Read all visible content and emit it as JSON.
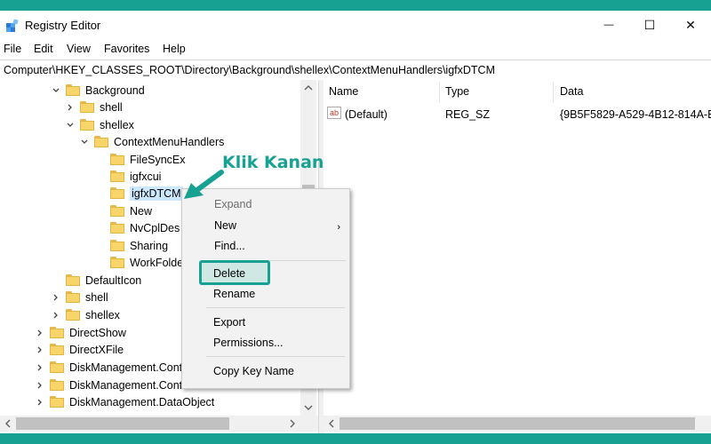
{
  "window": {
    "title": "Registry Editor",
    "minimize_glyph": "—",
    "maximize_glyph": "☐",
    "close_glyph": "✕"
  },
  "menubar": [
    "File",
    "Edit",
    "View",
    "Favorites",
    "Help"
  ],
  "address": "Computer\\HKEY_CLASSES_ROOT\\Directory\\Background\\shellex\\ContextMenuHandlers\\igfxDTCM",
  "tree": [
    {
      "label": "Background",
      "expanded": true
    },
    {
      "label": "shell",
      "expanded": false
    },
    {
      "label": "shellex",
      "expanded": true
    },
    {
      "label": "ContextMenuHandlers",
      "expanded": true
    },
    {
      "label": "FileSyncEx"
    },
    {
      "label": "igfxcui"
    },
    {
      "label": "igfxDTCM",
      "selected": true
    },
    {
      "label": "New"
    },
    {
      "label": "NvCplDes"
    },
    {
      "label": "Sharing"
    },
    {
      "label": "WorkFolde"
    },
    {
      "label": "DefaultIcon"
    },
    {
      "label": "shell",
      "expanded": false
    },
    {
      "label": "shellex",
      "expanded": false
    },
    {
      "label": "DirectShow",
      "expanded": false
    },
    {
      "label": "DirectXFile",
      "expanded": false
    },
    {
      "label": "DiskManagement.Cont",
      "expanded": false
    },
    {
      "label": "DiskManagement.Control",
      "expanded": false
    },
    {
      "label": "DiskManagement.DataObject",
      "expanded": false
    }
  ],
  "list": {
    "columns": [
      "Name",
      "Type",
      "Data"
    ],
    "rows": [
      {
        "name": "(Default)",
        "type": "REG_SZ",
        "data": "{9B5F5829-A529-4B12-814A-E"
      }
    ],
    "string_icon_text": "ab"
  },
  "context_menu": {
    "expand": "Expand",
    "new": "New",
    "new_arrow": "›",
    "find": "Find...",
    "delete": "Delete",
    "rename": "Rename",
    "export": "Export",
    "permissions": "Permissions...",
    "copy_key_name": "Copy Key Name"
  },
  "annotation": {
    "text": "Klik Kanan",
    "color": "#17a192"
  },
  "colors": {
    "accent": "#17a192",
    "selection": "#cce8ff"
  }
}
